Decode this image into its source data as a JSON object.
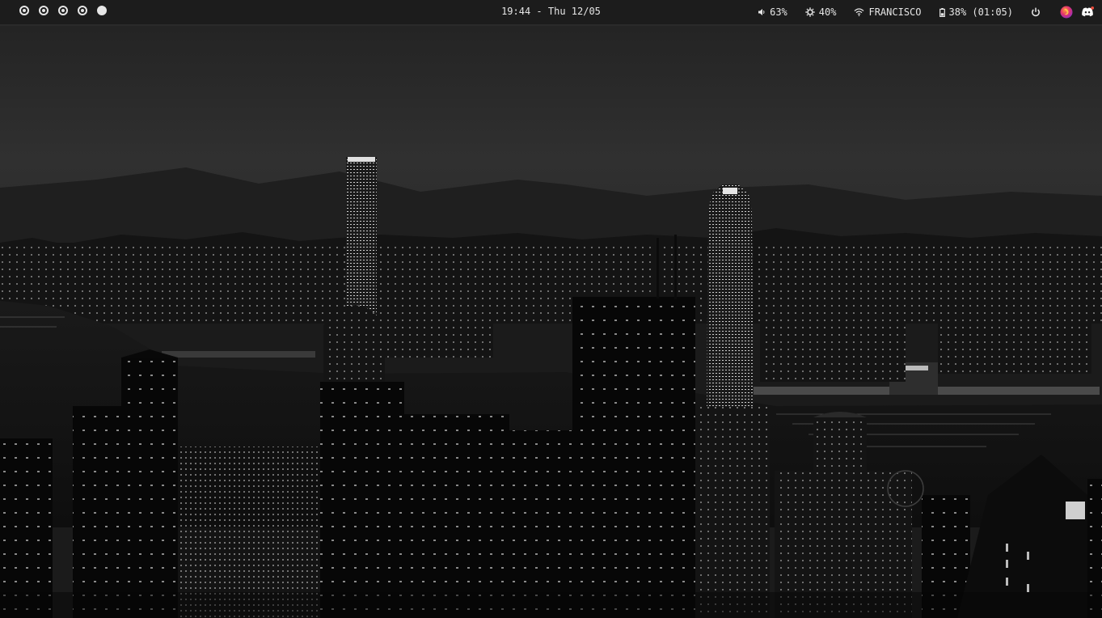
{
  "topbar": {
    "workspaces": [
      {
        "name": "workspace-1",
        "active": false
      },
      {
        "name": "workspace-2",
        "active": false
      },
      {
        "name": "workspace-3",
        "active": false
      },
      {
        "name": "workspace-4",
        "active": false
      },
      {
        "name": "workspace-5",
        "active": true
      }
    ],
    "clock": "19:44 - Thu 12/05",
    "volume": {
      "icon": "speaker-icon",
      "value": "63%"
    },
    "brightness": {
      "icon": "sun-icon",
      "value": "40%"
    },
    "network": {
      "icon": "wifi-icon",
      "ssid": "FRANCISCO"
    },
    "battery": {
      "icon": "battery-icon",
      "value": "38% (01:05)"
    },
    "power": {
      "icon": "power-icon"
    },
    "tray": [
      {
        "name": "firefox-tray-icon",
        "color": "#b33ad6"
      },
      {
        "name": "discord-tray-icon",
        "color": "#ffffff"
      }
    ]
  },
  "colors": {
    "bar_bg": "#1c1c1c",
    "bar_fg": "#e6e6e6",
    "sky": "#2b2b2b",
    "water": "#161616"
  }
}
